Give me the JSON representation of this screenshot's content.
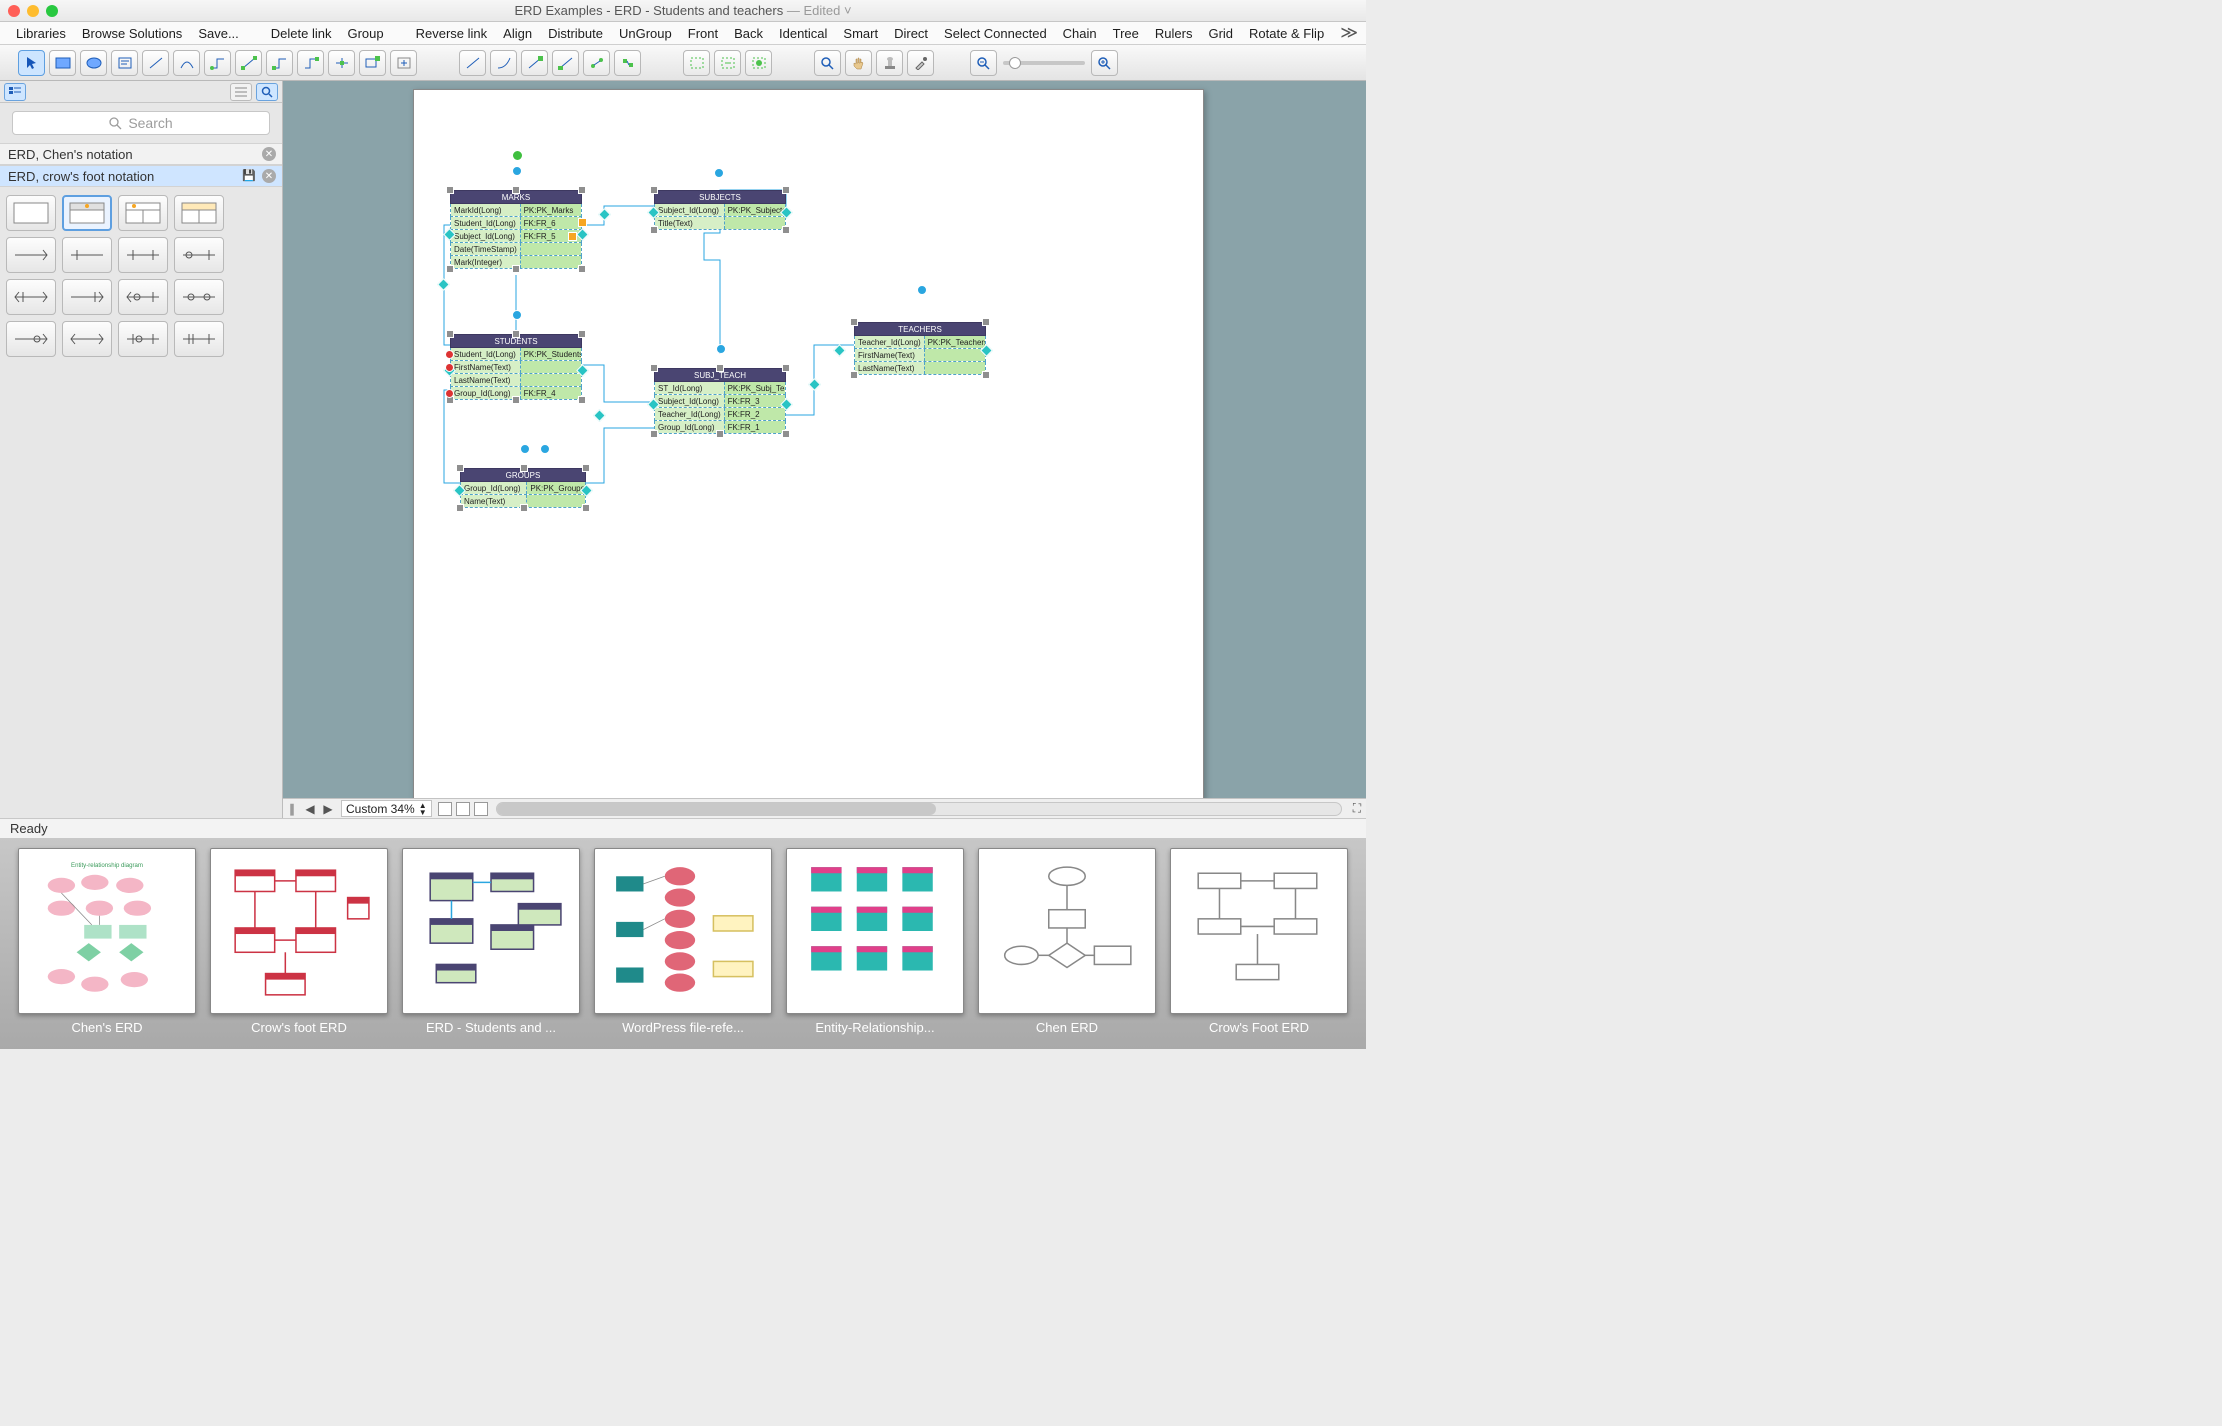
{
  "titlebar": {
    "title": "ERD Examples - ERD - Students and teachers",
    "suffix": " — Edited"
  },
  "menu": [
    "Libraries",
    "Browse Solutions",
    "Save...",
    "Delete link",
    "Group",
    "Reverse link",
    "Align",
    "Distribute",
    "UnGroup",
    "Front",
    "Back",
    "Identical",
    "Smart",
    "Direct",
    "Select Connected",
    "Chain",
    "Tree",
    "Rulers",
    "Grid",
    "Rotate & Flip"
  ],
  "search": {
    "placeholder": "Search"
  },
  "libs": [
    {
      "name": "ERD, Chen's notation",
      "active": false
    },
    {
      "name": "ERD, crow's foot notation",
      "active": true
    }
  ],
  "tables": {
    "marks": {
      "title": "MARKS",
      "rows": [
        [
          "MarkId(Long)",
          "PK:PK_Marks"
        ],
        [
          "Student_Id(Long)",
          "FK:FR_6"
        ],
        [
          "Subject_Id(Long)",
          "FK:FR_5"
        ],
        [
          "Date(TimeStamp)",
          ""
        ],
        [
          "Mark(Integer)",
          ""
        ]
      ]
    },
    "subjects": {
      "title": "SUBJECTS",
      "rows": [
        [
          "Subject_Id(Long)",
          "PK:PK_Subjects"
        ],
        [
          "Title(Text)",
          ""
        ]
      ]
    },
    "students": {
      "title": "STUDENTS",
      "rows": [
        [
          "Student_Id(Long)",
          "PK:PK_Students"
        ],
        [
          "FirstName(Text)",
          ""
        ],
        [
          "LastName(Text)",
          ""
        ],
        [
          "Group_Id(Long)",
          "FK:FR_4"
        ]
      ]
    },
    "subjteach": {
      "title": "SUBJ_TEACH",
      "rows": [
        [
          "ST_Id(Long)",
          "PK:PK_Subj_Teach"
        ],
        [
          "Subject_Id(Long)",
          "FK:FR_3"
        ],
        [
          "Teacher_Id(Long)",
          "FK:FR_2"
        ],
        [
          "Group_Id(Long)",
          "FK:FR_1"
        ]
      ]
    },
    "teachers": {
      "title": "TEACHERS",
      "rows": [
        [
          "Teacher_Id(Long)",
          "PK:PK_Teachers"
        ],
        [
          "FirstName(Text)",
          ""
        ],
        [
          "LastName(Text)",
          ""
        ]
      ]
    },
    "groups": {
      "title": "GROUPS",
      "rows": [
        [
          "Group_Id(Long)",
          "PK:PK_Groups"
        ],
        [
          "Name(Text)",
          ""
        ]
      ]
    }
  },
  "zoomlabel": "Custom 34%",
  "status": "Ready",
  "thumbs": [
    "Chen's ERD",
    "Crow's foot ERD",
    "ERD - Students and ...",
    "WordPress file-refe...",
    "Entity-Relationship...",
    "Chen ERD",
    "Crow's Foot ERD"
  ]
}
